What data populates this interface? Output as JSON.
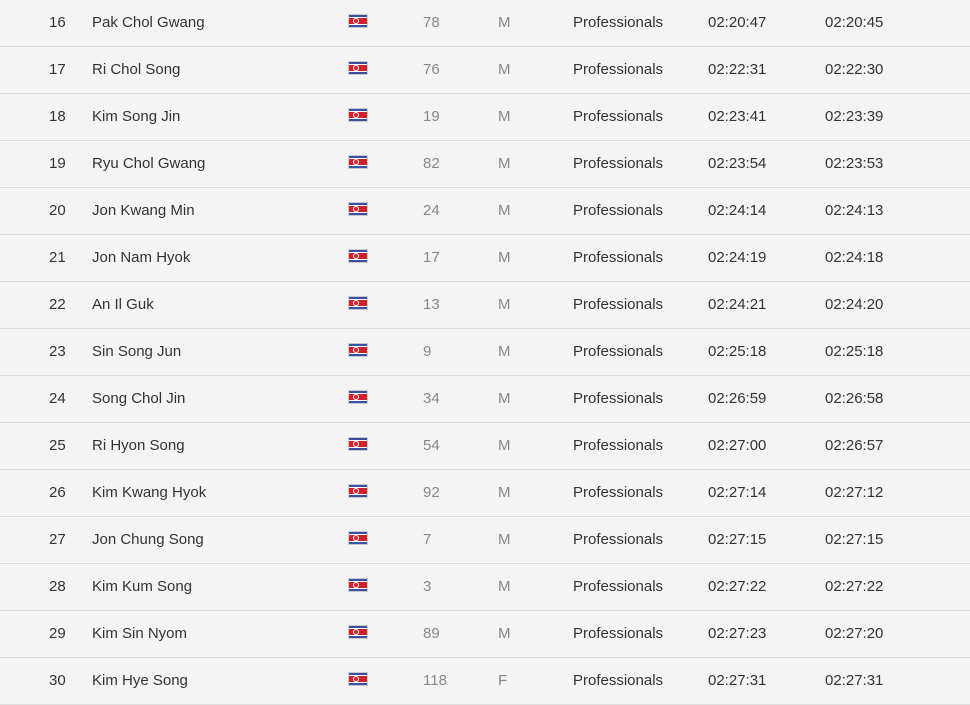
{
  "results": [
    {
      "rank": "16",
      "name": "Pak Chol Gwang",
      "flag": "north-korea-flag-icon",
      "bib": "78",
      "sex": "M",
      "category": "Professionals",
      "gun_time": "02:20:47",
      "chip_time": "02:20:45"
    },
    {
      "rank": "17",
      "name": "Ri Chol Song",
      "flag": "north-korea-flag-icon",
      "bib": "76",
      "sex": "M",
      "category": "Professionals",
      "gun_time": "02:22:31",
      "chip_time": "02:22:30"
    },
    {
      "rank": "18",
      "name": "Kim Song Jin",
      "flag": "north-korea-flag-icon",
      "bib": "19",
      "sex": "M",
      "category": "Professionals",
      "gun_time": "02:23:41",
      "chip_time": "02:23:39"
    },
    {
      "rank": "19",
      "name": "Ryu Chol Gwang",
      "flag": "north-korea-flag-icon",
      "bib": "82",
      "sex": "M",
      "category": "Professionals",
      "gun_time": "02:23:54",
      "chip_time": "02:23:53"
    },
    {
      "rank": "20",
      "name": "Jon Kwang Min",
      "flag": "north-korea-flag-icon",
      "bib": "24",
      "sex": "M",
      "category": "Professionals",
      "gun_time": "02:24:14",
      "chip_time": "02:24:13"
    },
    {
      "rank": "21",
      "name": "Jon Nam Hyok",
      "flag": "north-korea-flag-icon",
      "bib": "17",
      "sex": "M",
      "category": "Professionals",
      "gun_time": "02:24:19",
      "chip_time": "02:24:18"
    },
    {
      "rank": "22",
      "name": "An Il Guk",
      "flag": "north-korea-flag-icon",
      "bib": "13",
      "sex": "M",
      "category": "Professionals",
      "gun_time": "02:24:21",
      "chip_time": "02:24:20"
    },
    {
      "rank": "23",
      "name": "Sin Song Jun",
      "flag": "north-korea-flag-icon",
      "bib": "9",
      "sex": "M",
      "category": "Professionals",
      "gun_time": "02:25:18",
      "chip_time": "02:25:18"
    },
    {
      "rank": "24",
      "name": "Song Chol Jin",
      "flag": "north-korea-flag-icon",
      "bib": "34",
      "sex": "M",
      "category": "Professionals",
      "gun_time": "02:26:59",
      "chip_time": "02:26:58"
    },
    {
      "rank": "25",
      "name": "Ri Hyon Song",
      "flag": "north-korea-flag-icon",
      "bib": "54",
      "sex": "M",
      "category": "Professionals",
      "gun_time": "02:27:00",
      "chip_time": "02:26:57"
    },
    {
      "rank": "26",
      "name": "Kim Kwang Hyok",
      "flag": "north-korea-flag-icon",
      "bib": "92",
      "sex": "M",
      "category": "Professionals",
      "gun_time": "02:27:14",
      "chip_time": "02:27:12"
    },
    {
      "rank": "27",
      "name": "Jon Chung Song",
      "flag": "north-korea-flag-icon",
      "bib": "7",
      "sex": "M",
      "category": "Professionals",
      "gun_time": "02:27:15",
      "chip_time": "02:27:15"
    },
    {
      "rank": "28",
      "name": "Kim Kum Song",
      "flag": "north-korea-flag-icon",
      "bib": "3",
      "sex": "M",
      "category": "Professionals",
      "gun_time": "02:27:22",
      "chip_time": "02:27:22"
    },
    {
      "rank": "29",
      "name": "Kim Sin Nyom",
      "flag": "north-korea-flag-icon",
      "bib": "89",
      "sex": "M",
      "category": "Professionals",
      "gun_time": "02:27:23",
      "chip_time": "02:27:20"
    },
    {
      "rank": "30",
      "name": "Kim Hye Song",
      "flag": "north-korea-flag-icon",
      "bib": "118",
      "sex": "F",
      "category": "Professionals",
      "gun_time": "02:27:31",
      "chip_time": "02:27:31"
    }
  ],
  "colors": {
    "background": "#f4f4f4",
    "row_divider": "#dcdcdc",
    "text_primary": "#333333",
    "text_muted": "#888888",
    "flag_blue": "#3b4fa3",
    "flag_red": "#d4202a"
  }
}
